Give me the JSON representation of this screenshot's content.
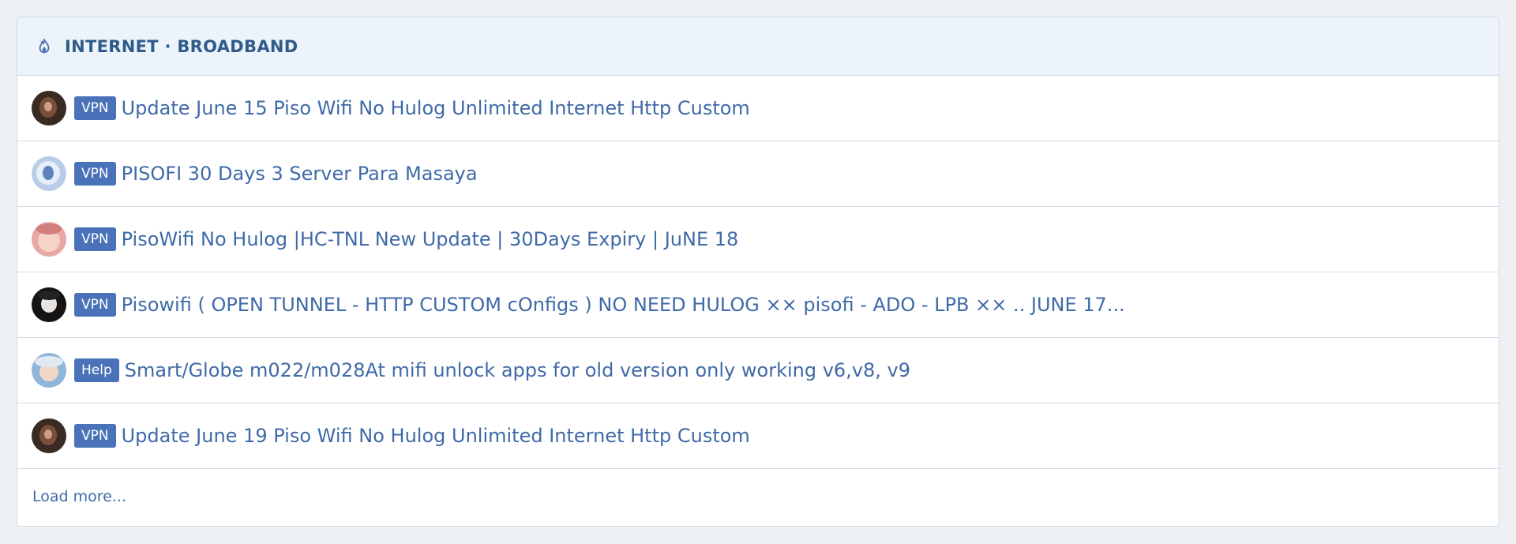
{
  "header": {
    "title": "INTERNET · BROADBAND",
    "icon": "flame-icon",
    "color": "#2f5b8a"
  },
  "threads": [
    {
      "prefix": "VPN",
      "title": "Update June 15 Piso Wifi No Hulog Unlimited Internet Http Custom",
      "avatar": "dark"
    },
    {
      "prefix": "VPN",
      "title": "PISOFI 30 Days 3 Server Para Masaya",
      "avatar": "blue"
    },
    {
      "prefix": "VPN",
      "title": "PisoWifi No Hulog |HC-TNL New Update | 30Days Expiry | JuNE 18",
      "avatar": "pink"
    },
    {
      "prefix": "VPN",
      "title": "Pisowifi ( OPEN TUNNEL - HTTP CUSTOM cOnfigs ) NO NEED HULOG ×× pisofi - ADO - LPB ×× .. JUNE 17...",
      "avatar": "black"
    },
    {
      "prefix": "Help",
      "title": "Smart/Globe m022/m028At mifi unlock apps for old version only working v6,v8, v9",
      "avatar": "anime"
    },
    {
      "prefix": "VPN",
      "title": "Update June 19 Piso Wifi No Hulog Unlimited Internet Http Custom",
      "avatar": "dark"
    }
  ],
  "footer": {
    "load_more": "Load more..."
  },
  "colors": {
    "badge": "#4a72b8",
    "link": "#3f6aa8",
    "header_bg": "#edf3fa"
  }
}
